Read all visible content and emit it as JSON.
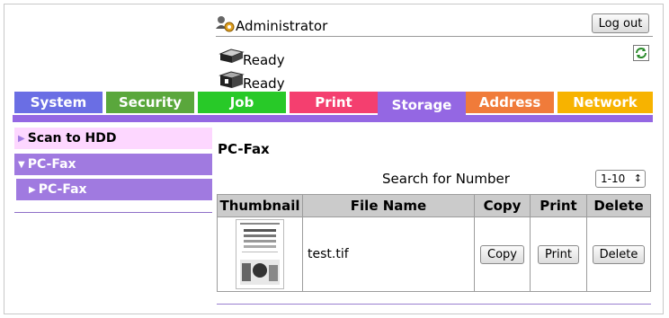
{
  "header": {
    "user_label": "Administrator",
    "logout_label": "Log out",
    "status_lines": [
      "Ready",
      "Ready"
    ]
  },
  "tabs": [
    {
      "label": "System",
      "color": "#6a6ee4"
    },
    {
      "label": "Security",
      "color": "#5aa73c"
    },
    {
      "label": "Job",
      "color": "#28c928"
    },
    {
      "label": "Print",
      "color": "#f43f6f"
    },
    {
      "label": "Storage",
      "color": "#9467e3",
      "active": true
    },
    {
      "label": "Address",
      "color": "#f07b3a"
    },
    {
      "label": "Network",
      "color": "#f7b300"
    }
  ],
  "sidebar": {
    "items": [
      {
        "label": "Scan to HDD"
      },
      {
        "label": "PC-Fax"
      },
      {
        "label": "PC-Fax"
      }
    ]
  },
  "main": {
    "title": "PC-Fax",
    "search_label": "Search for Number",
    "range_value": "1-10",
    "columns": [
      "Thumbnail",
      "File Name",
      "Copy",
      "Print",
      "Delete"
    ],
    "rows": [
      {
        "file_name": "test.tif",
        "copy_label": "Copy",
        "print_label": "Print",
        "delete_label": "Delete"
      }
    ]
  }
}
